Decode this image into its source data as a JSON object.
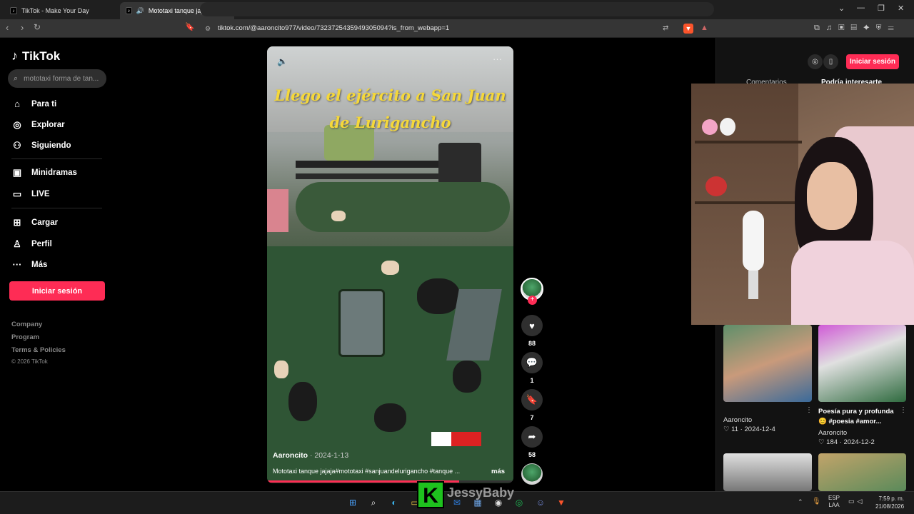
{
  "browser": {
    "tabs": [
      {
        "title": "TikTok - Make Your Day",
        "active": false
      },
      {
        "title": "Mototaxi tanque jajaja #motot",
        "active": true
      }
    ],
    "url": "tiktok.com/@aaroncito977/video/7323725435949305094?is_from_webapp=1"
  },
  "sidebar": {
    "logo": "TikTok",
    "search_placeholder": "mototaxi forma de tan...",
    "nav": [
      {
        "label": "Para ti",
        "icon": "home-icon"
      },
      {
        "label": "Explorar",
        "icon": "compass-icon"
      },
      {
        "label": "Siguiendo",
        "icon": "following-icon"
      },
      {
        "label": "Minidramas",
        "icon": "minidramas-icon"
      },
      {
        "label": "LIVE",
        "icon": "live-icon"
      },
      {
        "label": "Cargar",
        "icon": "upload-icon"
      },
      {
        "label": "Perfil",
        "icon": "profile-icon"
      },
      {
        "label": "Más",
        "icon": "more-icon"
      }
    ],
    "login": "Iniciar sesión",
    "footer": [
      "Company",
      "Program",
      "Terms & Policies",
      "© 2026 TikTok"
    ]
  },
  "video": {
    "overlay_title": "Llego el ejército a San Juan de Lurigancho",
    "author": "Aaroncito",
    "date": "2024-1-13",
    "caption": "Mototaxi tanque jajaja#mototaxi #sanjuandelurigancho #tanque ...",
    "more": "más",
    "progress": 0.78
  },
  "actions": {
    "likes": "88",
    "comments": "1",
    "saves": "7",
    "shares": "58"
  },
  "right_panel": {
    "login": "Iniciar sesión",
    "tab_comments": "Comentarios",
    "tab_interest": "Podría interesarte",
    "videos": [
      {
        "title": "",
        "author": "Aaroncito",
        "likes": "11",
        "date": "2024-12-4"
      },
      {
        "title": "Poesía pura y profunda 😊 #poesia #amor...",
        "author": "Aaroncito",
        "likes": "184",
        "date": "2024-12-2"
      }
    ]
  },
  "overlay": {
    "streamer_name": "JessyBaby"
  },
  "taskbar": {
    "lang": "ESP",
    "lang2": "LAA",
    "time": "7:59 p. m.",
    "date": "21/08/2026"
  }
}
